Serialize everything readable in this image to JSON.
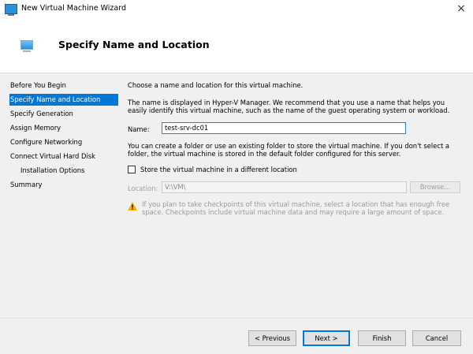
{
  "window": {
    "title": "New Virtual Machine Wizard",
    "close_glyph": "×"
  },
  "header": {
    "title": "Specify Name and Location"
  },
  "sidebar": {
    "items": [
      {
        "label": "Before You Begin",
        "active": false
      },
      {
        "label": "Specify Name and Location",
        "active": true
      },
      {
        "label": "Specify Generation",
        "active": false
      },
      {
        "label": "Assign Memory",
        "active": false
      },
      {
        "label": "Configure Networking",
        "active": false
      },
      {
        "label": "Connect Virtual Hard Disk",
        "active": false
      },
      {
        "label": "Installation Options",
        "active": false
      },
      {
        "label": "Summary",
        "active": false
      }
    ]
  },
  "content": {
    "intro": "Choose a name and location for this virtual machine.",
    "name_help": "The name is displayed in Hyper-V Manager. We recommend that you use a name that helps you easily identify this virtual machine, such as the name of the guest operating system or workload.",
    "name_label": "Name:",
    "name_value": "test-srv-dc01",
    "folder_help": "You can create a folder or use an existing folder to store the virtual machine. If you don't select a folder, the virtual machine is stored in the default folder configured for this server.",
    "store_checkbox_label": "Store the virtual machine in a different location",
    "store_checked": false,
    "location_label": "Location:",
    "location_value": "V:\\VM\\",
    "browse_label": "Browse...",
    "warning_text": "If you plan to take checkpoints of this virtual machine, select a location that has enough free space. Checkpoints include virtual machine data and may require a large amount of space."
  },
  "footer": {
    "previous_label": "< Previous",
    "next_label": "Next >",
    "finish_label": "Finish",
    "cancel_label": "Cancel"
  },
  "colors": {
    "accent": "#0078d7",
    "warning": "#f0b400"
  }
}
